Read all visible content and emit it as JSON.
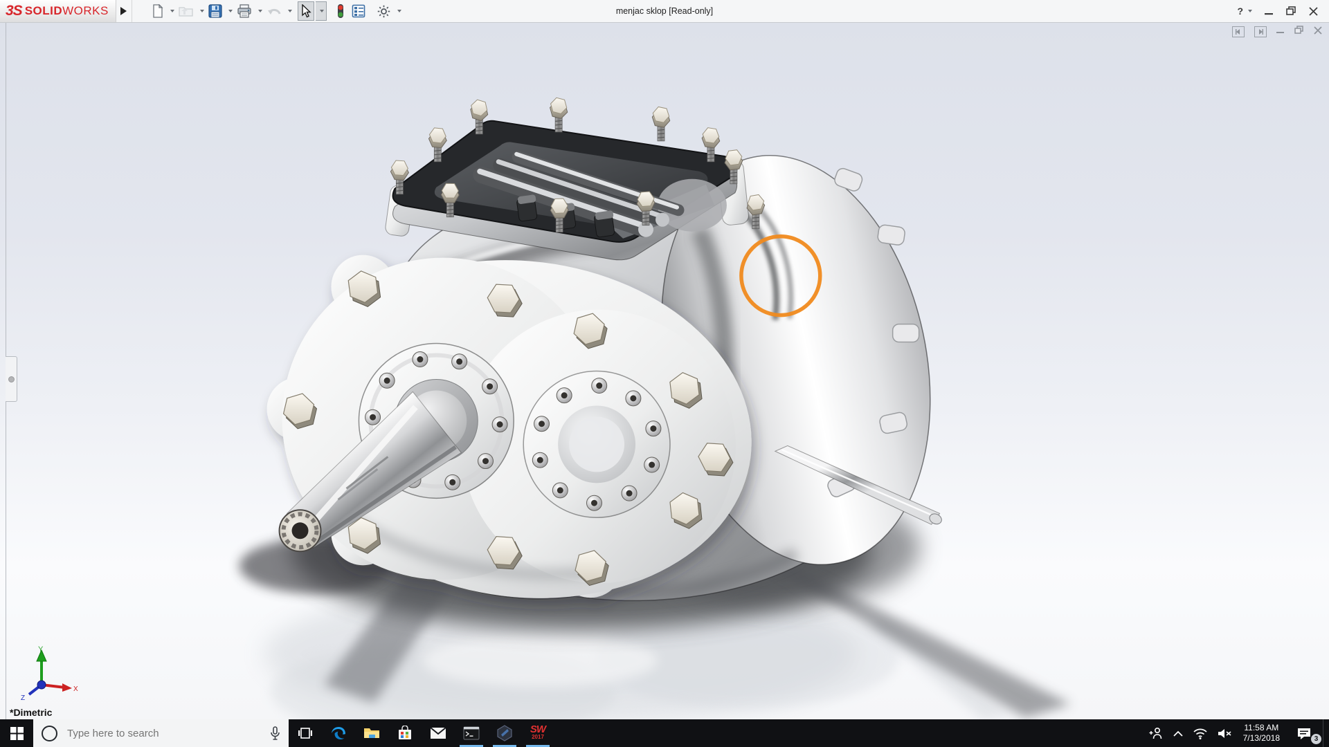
{
  "titlebar": {
    "brand_bold": "SOLID",
    "brand_light": "WORKS",
    "ds_mark": "3S",
    "title": "menjac sklop [Read-only]",
    "help_label": "?"
  },
  "toolbar_icons": [
    "new-document",
    "open",
    "save",
    "print",
    "undo",
    "select-cursor",
    "traffic-light",
    "design-checker",
    "options-gear"
  ],
  "document_window_icons": [
    "previous-pane",
    "next-pane",
    "minimize",
    "restore",
    "close"
  ],
  "viewport": {
    "orientation_label": "*Dimetric",
    "triad": {
      "x_label": "X",
      "y_label": "Y",
      "z_label": "Z"
    },
    "annotation": {
      "shape": "circle",
      "color": "#F08A1E"
    }
  },
  "taskbar": {
    "search_placeholder": "Type here to search",
    "clock_time": "11:58 AM",
    "clock_date": "7/13/2018",
    "notification_count": "3",
    "solidworks_icon_text": "SW",
    "solidworks_icon_year": "2017",
    "app_icons": [
      "task-view",
      "edge",
      "file-explorer",
      "store",
      "mail",
      "command-prompt",
      "hexagon-app",
      "solidworks-2017"
    ],
    "running_apps": [
      "command-prompt",
      "hexagon-app",
      "solidworks-2017"
    ],
    "tray_icons": [
      "people",
      "chevron-up",
      "wifi",
      "volume-muted",
      "clock",
      "notifications",
      "show-desktop"
    ]
  },
  "colors": {
    "annotation_orange": "#F08A1E",
    "taskbar_bg": "#101114",
    "running_underline": "#76B9ED",
    "brand_red": "#D8262B"
  }
}
